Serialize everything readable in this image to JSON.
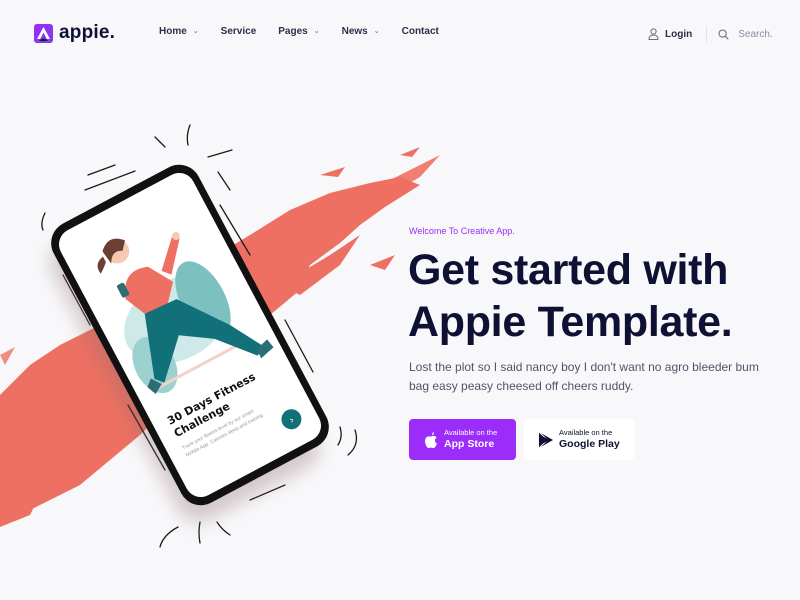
{
  "header": {
    "logo_text": "appie.",
    "nav": [
      {
        "label": "Home",
        "has_dropdown": true
      },
      {
        "label": "Service",
        "has_dropdown": false
      },
      {
        "label": "Pages",
        "has_dropdown": true
      },
      {
        "label": "News",
        "has_dropdown": true
      },
      {
        "label": "Contact",
        "has_dropdown": false
      }
    ],
    "login_label": "Login",
    "search_placeholder": "Search.",
    "dropdown_glyph": "⌄"
  },
  "hero": {
    "eyebrow": "Welcome To Creative App.",
    "headline_line1": "Get started with",
    "headline_line2": "Appie Template.",
    "lead": "Lost the plot so I said nancy boy I don't want no agro bleeder bum bag easy peasy cheesed off cheers ruddy.",
    "buttons": {
      "appstore": {
        "small": "Available on the",
        "big": "App Store",
        "icon": "apple-icon"
      },
      "google": {
        "small": "Available on the",
        "big": "Google Play",
        "icon": "google-play-icon"
      }
    }
  },
  "phone_screen": {
    "title_line1": "30 Days Fitness",
    "title_line2": "Challenge",
    "desc_line1": "Track your fitness level by our smart",
    "desc_line2": "Mobile App. Calories sleep and training .",
    "next_glyph": "›"
  },
  "colors": {
    "brand": "#9b2cfa",
    "heading": "#0e1133",
    "splash": "#ee7062",
    "teal": "#127079"
  }
}
